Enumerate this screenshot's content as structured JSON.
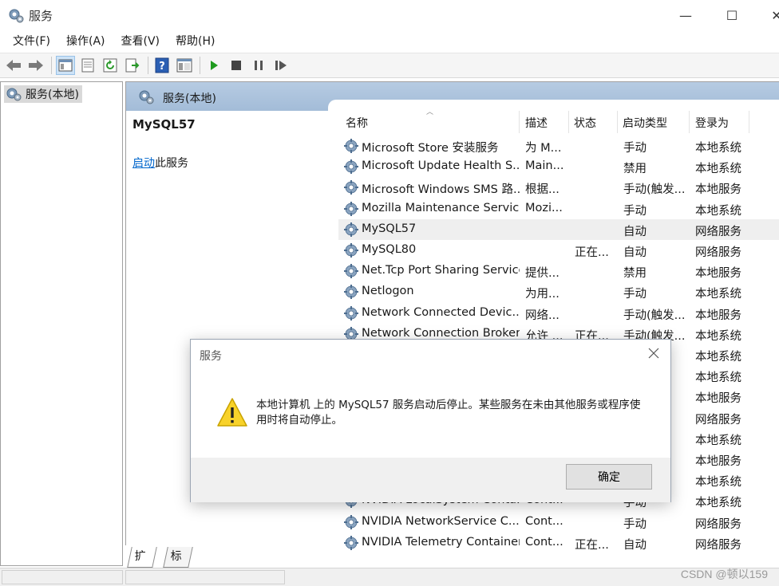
{
  "window": {
    "title": "服务",
    "minimize": "—",
    "maximize": "☐",
    "close": "✕"
  },
  "menu": [
    "文件(F)",
    "操作(A)",
    "查看(V)",
    "帮助(H)"
  ],
  "toolbar": {
    "icons": [
      "back-arrow-icon",
      "forward-arrow-icon",
      "show-hide-tree-icon",
      "properties-icon",
      "refresh-icon",
      "export-list-icon",
      "help-icon",
      "console-icon",
      "start-service-icon",
      "stop-service-icon",
      "pause-service-icon",
      "resume-service-icon"
    ]
  },
  "tree": {
    "root_label": "服务(本地)"
  },
  "pane": {
    "header": "服务(本地)",
    "selected_service": "MySQL57",
    "start_link": "启动",
    "start_suffix": "此服务"
  },
  "columns": {
    "name": "名称",
    "desc": "描述",
    "status": "状态",
    "start_type": "启动类型",
    "logon": "登录为"
  },
  "services": [
    {
      "name": "Microsoft Store 安装服务",
      "desc": "为 M...",
      "status": "",
      "start": "手动",
      "logon": "本地系统"
    },
    {
      "name": "Microsoft Update Health S...",
      "desc": "Main...",
      "status": "",
      "start": "禁用",
      "logon": "本地系统"
    },
    {
      "name": "Microsoft Windows SMS 路...",
      "desc": "根据...",
      "status": "",
      "start": "手动(触发...",
      "logon": "本地服务"
    },
    {
      "name": "Mozilla Maintenance Service",
      "desc": "Mozi...",
      "status": "",
      "start": "手动",
      "logon": "本地系统"
    },
    {
      "name": "MySQL57",
      "desc": "",
      "status": "",
      "start": "自动",
      "logon": "网络服务"
    },
    {
      "name": "MySQL80",
      "desc": "",
      "status": "正在...",
      "start": "自动",
      "logon": "网络服务"
    },
    {
      "name": "Net.Tcp Port Sharing Service",
      "desc": "提供...",
      "status": "",
      "start": "禁用",
      "logon": "本地服务"
    },
    {
      "name": "Netlogon",
      "desc": "为用...",
      "status": "",
      "start": "手动",
      "logon": "本地系统"
    },
    {
      "name": "Network Connected Devic...",
      "desc": "网络...",
      "status": "",
      "start": "手动(触发...",
      "logon": "本地服务"
    },
    {
      "name": "Network Connection Broker",
      "desc": "允许 ...",
      "status": "正在...",
      "start": "手动(触发...",
      "logon": "本地系统"
    },
    {
      "name": "",
      "desc": "",
      "status": "",
      "start": "",
      "logon": "本地系统"
    },
    {
      "name": "",
      "desc": "",
      "status": "",
      "start": "发...",
      "logon": "本地系统"
    },
    {
      "name": "",
      "desc": "",
      "status": "",
      "start": "",
      "logon": "本地服务"
    },
    {
      "name": "",
      "desc": "",
      "status": "",
      "start": "",
      "logon": "网络服务"
    },
    {
      "name": "",
      "desc": "",
      "status": "",
      "start": "发...",
      "logon": "本地系统"
    },
    {
      "name": "",
      "desc": "",
      "status": "",
      "start": "",
      "logon": "本地服务"
    },
    {
      "name": "",
      "desc": "",
      "status": "",
      "start": "",
      "logon": "本地系统"
    },
    {
      "name": "NVIDIA LocalSystem Conta...",
      "desc": "Cont...",
      "status": "",
      "start": "手动",
      "logon": "本地系统"
    },
    {
      "name": "NVIDIA NetworkService C...",
      "desc": "Cont...",
      "status": "",
      "start": "手动",
      "logon": "网络服务"
    },
    {
      "name": "NVIDIA Telemetry Container",
      "desc": "Cont...",
      "status": "正在...",
      "start": "自动",
      "logon": "网络服务"
    }
  ],
  "tabs": [
    "扩展",
    "标准"
  ],
  "dialog": {
    "title": "服务",
    "message": "本地计算机 上的 MySQL57 服务启动后停止。某些服务在未由其他服务或程序使用时将自动停止。",
    "ok": "确定"
  },
  "watermark": "CSDN @顿以159"
}
